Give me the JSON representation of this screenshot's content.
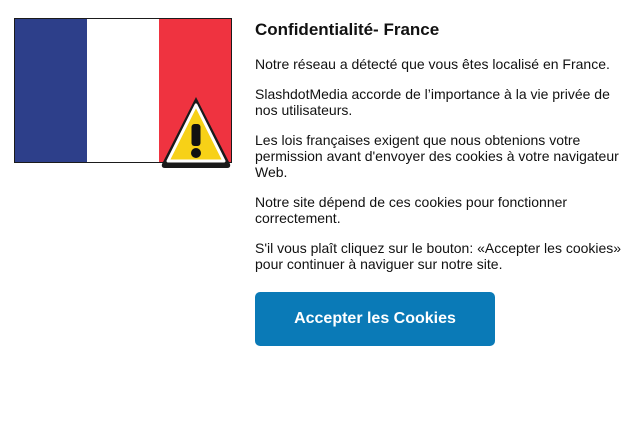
{
  "title": "Confidentialité- France",
  "paragraphs": [
    "Notre réseau a détecté que vous êtes localisé en France.",
    "SlashdotMedia accorde de l’importance à la vie privée de nos utilisateurs.",
    "Les lois françaises exigent que nous obtenions votre permission avant d'envoyer des cookies à votre navigateur Web.",
    "Notre site dépend de ces cookies pour fonctionner correctement.",
    "S'il vous plaît cliquez sur le bouton: «Accepter les cookies» pour continuer à naviguer sur notre site."
  ],
  "button": {
    "label": "Accepter les Cookies"
  },
  "icons": {
    "flag": "france-flag-icon",
    "warning": "warning-icon"
  },
  "colors": {
    "accent": "#0a7ab7",
    "flag_blue": "#2d3f8a",
    "flag_white": "#ffffff",
    "flag_red": "#ef3340",
    "warning_yellow": "#f7d117"
  }
}
